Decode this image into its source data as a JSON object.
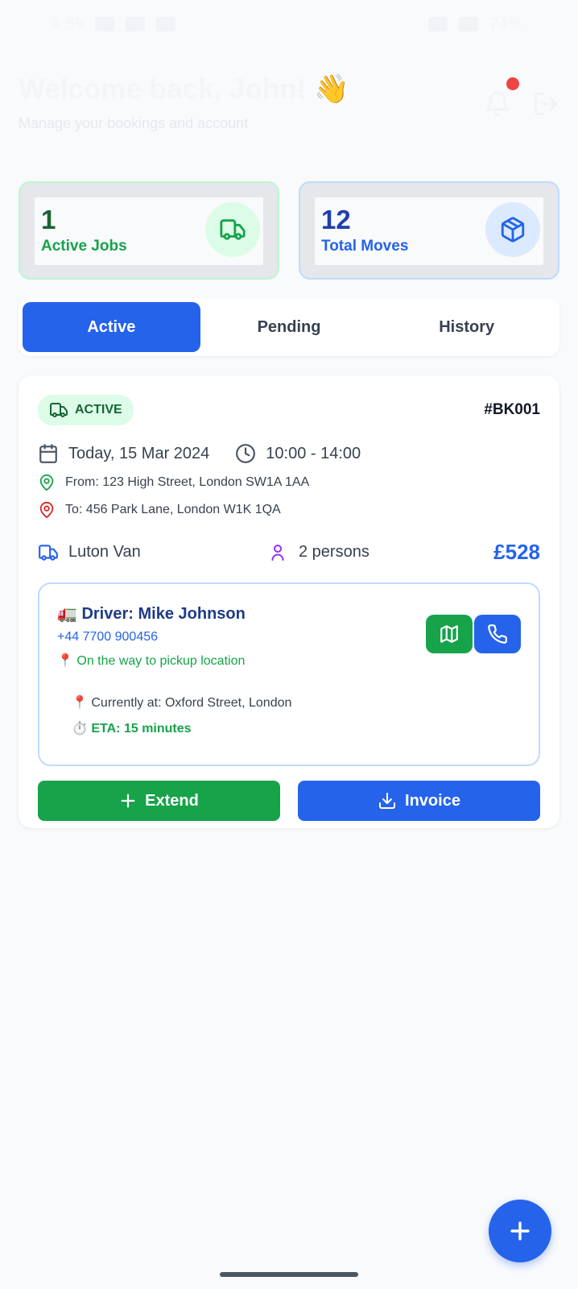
{
  "status_bar": {
    "time": "4:59",
    "battery": "74%"
  },
  "header": {
    "welcome": "Welcome back, John! 👋",
    "subtitle": "Manage your bookings and account"
  },
  "stats": [
    {
      "value": "1",
      "label": "Active Jobs",
      "icon": "truck-icon",
      "color": "#16a34a"
    },
    {
      "value": "12",
      "label": "Total Moves",
      "icon": "box-icon",
      "color": "#2563eb"
    }
  ],
  "tabs": [
    {
      "label": "Active",
      "active": true
    },
    {
      "label": "Pending",
      "active": false
    },
    {
      "label": "History",
      "active": false
    }
  ],
  "booking": {
    "status": "ACTIVE",
    "id": "#BK001",
    "date": "Today, 15 Mar 2024",
    "time": "10:00 - 14:00",
    "from": "From: 123 High Street, London SW1A 1AA",
    "to": "To: 456 Park Lane, London W1K 1QA",
    "vehicle": "Luton Van",
    "persons": "2 persons",
    "price": "£528",
    "driver": {
      "name": "🚛 Driver: Mike Johnson",
      "phone": "+44 7700 900456",
      "status": "📍 On the way to pickup location",
      "location": "📍 Currently at: Oxford Street, London",
      "eta": "⏱️ ETA: 15 minutes"
    },
    "actions": {
      "extend": "Extend",
      "invoice": "Invoice"
    }
  },
  "colors": {
    "primary": "#2563eb",
    "success": "#16a34a",
    "notification": "#ef4444"
  }
}
